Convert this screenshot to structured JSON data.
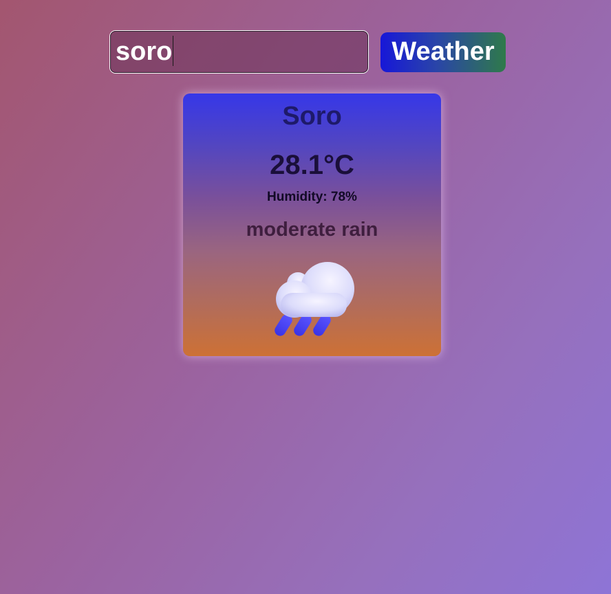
{
  "search": {
    "value": "soro",
    "button_label": "Weather"
  },
  "weather": {
    "city": "Soro",
    "temperature": "28.1°C",
    "humidity": "Humidity: 78%",
    "description": "moderate rain",
    "icon": "cloud-rain-icon"
  },
  "colors": {
    "button_gradient_start": "#1717d8",
    "button_gradient_end": "#2f7a4a",
    "card_gradient_top": "#3637e8",
    "card_gradient_bottom": "#cd7135"
  }
}
